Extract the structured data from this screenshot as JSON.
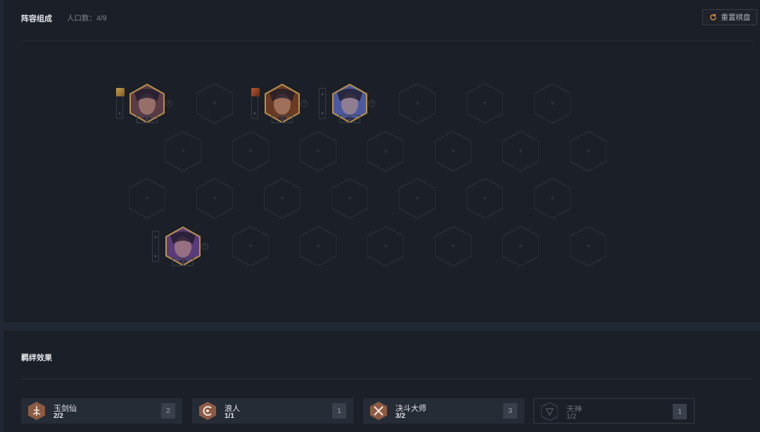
{
  "board": {
    "title": "阵容组成",
    "population": "人口数：4/9",
    "reset_label": "重置棋盘"
  },
  "traits_panel": {
    "title": "羁绊效果",
    "traits": [
      {
        "name": "玉剑仙",
        "progress": "2/2",
        "count": "2",
        "color": "#8c5a43",
        "icon": "sword-immortal-icon"
      },
      {
        "name": "浪人",
        "progress": "1/1",
        "count": "1",
        "color": "#8c5a43",
        "icon": "ronin-icon"
      },
      {
        "name": "决斗大师",
        "progress": "3/2",
        "count": "3",
        "color": "#8c5a43",
        "icon": "duelist-icon"
      },
      {
        "name": "天神",
        "progress": "1/2",
        "count": "1",
        "color": "#3b414c",
        "icon": "divine-icon"
      }
    ]
  },
  "champions": [
    {
      "name": "champion-1",
      "portrait_color": "#5a3b46"
    },
    {
      "name": "champion-2",
      "portrait_color": "#6b3a22"
    },
    {
      "name": "champion-3",
      "portrait_color": "#4b5aa0"
    },
    {
      "name": "champion-4",
      "portrait_color": "#5a3b7a"
    }
  ],
  "colors": {
    "gold_border": "#b9904a",
    "hex_empty": "#262b34",
    "trait_active": "#8c5a43"
  }
}
